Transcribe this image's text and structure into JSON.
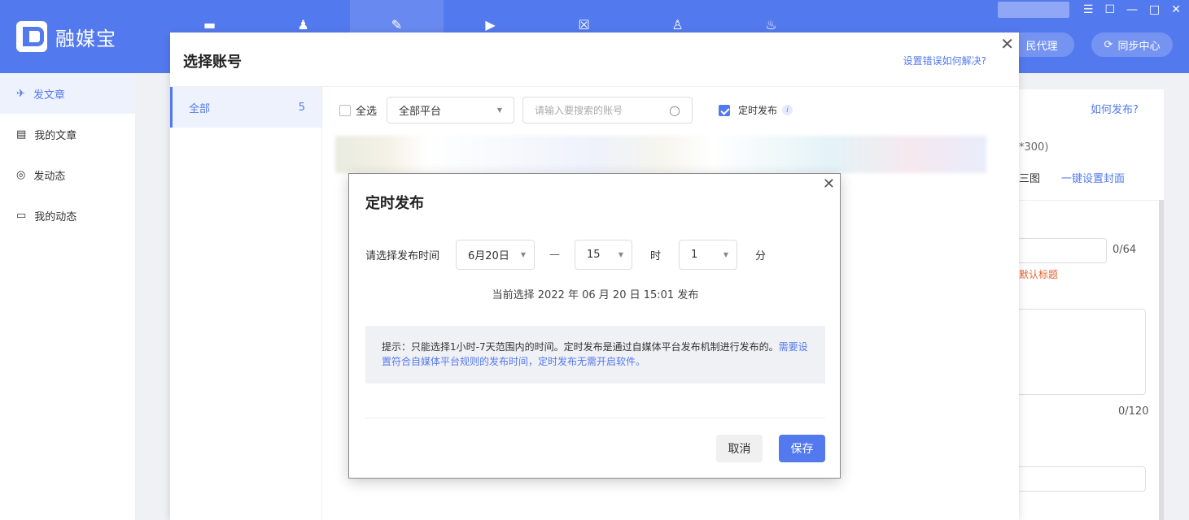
{
  "app": {
    "name": "融媒宝"
  },
  "topbar": {
    "nav_icons": [
      "▬",
      "♟",
      "✎",
      "▶",
      "☒",
      "♙",
      "♨"
    ],
    "window_controls": [
      "☰",
      "☐",
      "—",
      "□",
      "✕"
    ],
    "pill_left": "全民代理",
    "pill_left_visible": "民代理",
    "pill_right": "同步中心"
  },
  "sidebar": {
    "items": [
      {
        "icon": "✈",
        "label": "发文章"
      },
      {
        "icon": "▤",
        "label": "我的文章"
      },
      {
        "icon": "◎",
        "label": "发动态"
      },
      {
        "icon": "▭",
        "label": "我的动态"
      }
    ]
  },
  "background": {
    "how_to_publish": "如何发布?",
    "size_hint": "*300)",
    "three_images": "三图",
    "one_click_cover": "一键设置封面",
    "title_count": "0/64",
    "default_title": "默认标题",
    "summary_count": "0/120"
  },
  "select_account_dialog": {
    "title": "选择账号",
    "help_link": "设置错误如何解决?",
    "close": "✕",
    "groups": [
      {
        "name": "全部",
        "count": "5"
      }
    ],
    "select_all": "全选",
    "platform_filter": "全部平台",
    "search_placeholder": "请输入要搜索的账号",
    "scheduled_label": "定时发布",
    "info_icon": "i"
  },
  "schedule_dialog": {
    "title": "定时发布",
    "close": "✕",
    "label": "请选择发布时间",
    "date": "6月20日",
    "dash": "—",
    "hour": "15",
    "hour_unit": "时",
    "minute": "1",
    "minute_unit": "分",
    "current_selection": "当前选择 2022 年 06 月 20 日 15:01 发布",
    "tip_black": "提示：只能选择1小时-7天范围内的时间。定时发布是通过自媒体平台发布机制进行发布的。",
    "tip_blue": "需要设置符合自媒体平台规则的发布时间，定时发布无需开启软件。",
    "cancel": "取消",
    "save": "保存"
  }
}
